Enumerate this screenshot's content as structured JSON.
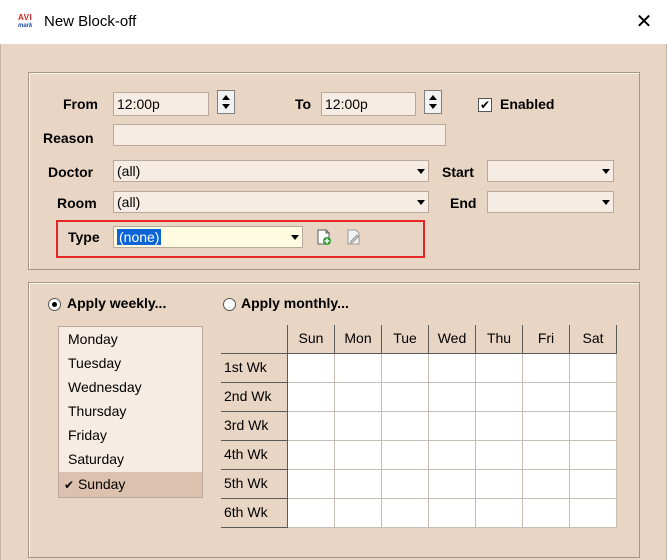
{
  "window": {
    "title": "New Block-off",
    "logo_top": "AVI",
    "logo_bottom": "mark",
    "close_glyph": "✕"
  },
  "form": {
    "from_label": "From",
    "from_value": "12:00p",
    "to_label": "To",
    "to_value": "12:00p",
    "enabled_label": "Enabled",
    "enabled_checked": "✔",
    "reason_label": "Reason",
    "reason_value": "",
    "doctor_label": "Doctor",
    "doctor_value": "(all)",
    "start_label": "Start",
    "start_value": "",
    "room_label": "Room",
    "room_value": "(all)",
    "end_label": "End",
    "end_value": "",
    "type_label": "Type",
    "type_value": "(none)"
  },
  "recurrence": {
    "weekly_label": "Apply weekly...",
    "monthly_label": "Apply monthly...",
    "days": [
      "Monday",
      "Tuesday",
      "Wednesday",
      "Thursday",
      "Friday",
      "Saturday",
      "Sunday"
    ],
    "selected_day_check": "✔",
    "grid_columns": [
      "Sun",
      "Mon",
      "Tue",
      "Wed",
      "Thu",
      "Fri",
      "Sat"
    ],
    "grid_rows": [
      "1st Wk",
      "2nd Wk",
      "3rd Wk",
      "4th Wk",
      "5th Wk",
      "6th Wk"
    ]
  },
  "colors": {
    "dialog_bg": "#e8d5c4",
    "field_bg": "#f6ece4",
    "highlight": "#e62626",
    "selection": "#0a64d8"
  },
  "icons": {
    "new_type": "add-document-icon",
    "edit_type": "edit-document-icon",
    "spinner": "spinner-arrows-icon",
    "dropdown": "dropdown-arrow-icon"
  }
}
